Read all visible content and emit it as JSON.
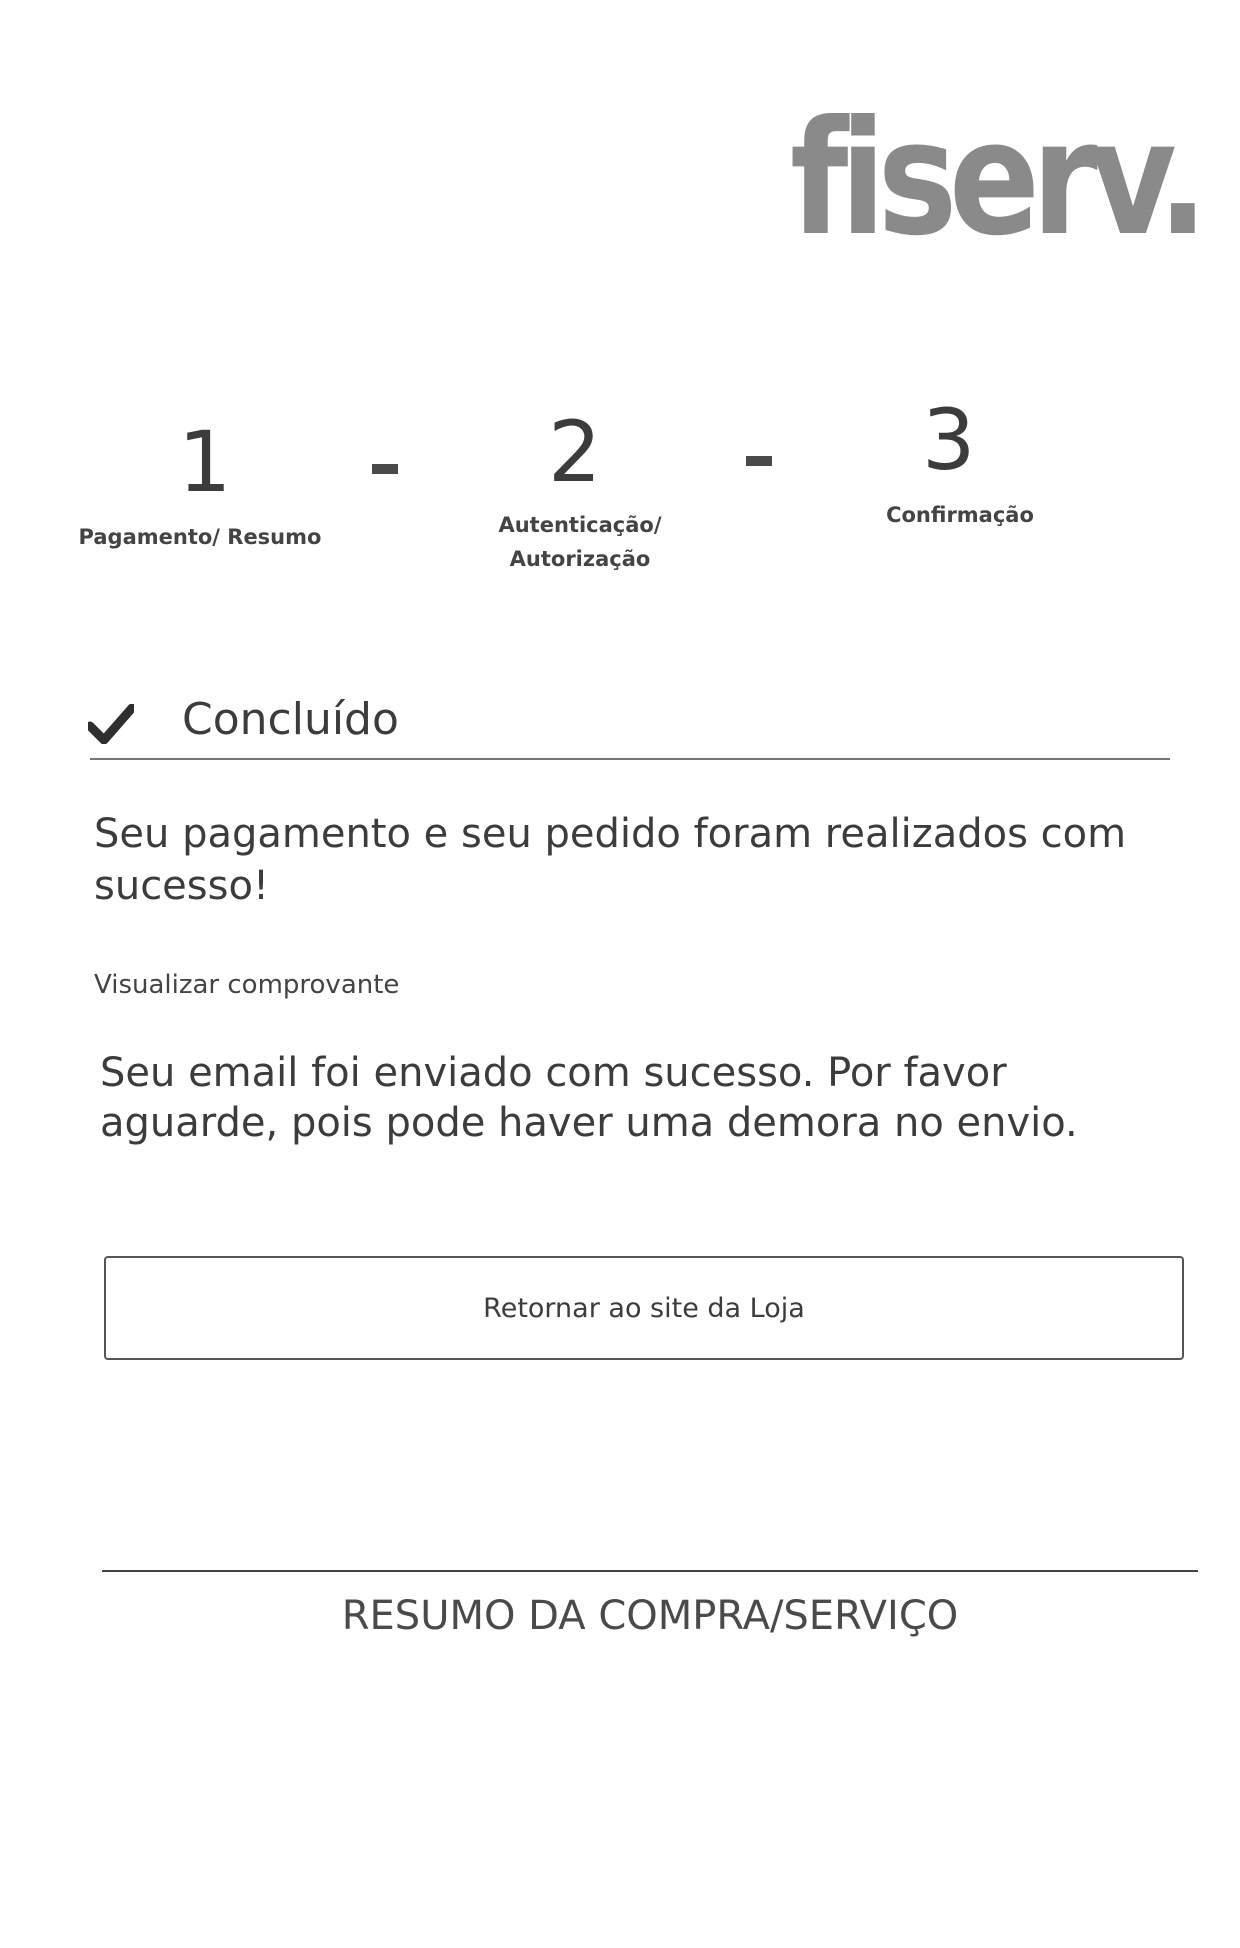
{
  "brand": {
    "logo_text": "fiserv."
  },
  "steps": [
    {
      "number": "1",
      "label": "Pagamento/ Resumo"
    },
    {
      "number": "2",
      "label": "Autenticação/\nAutorização"
    },
    {
      "number": "3",
      "label": "Confirmação"
    }
  ],
  "steps_separator": "-",
  "status": {
    "icon": "check-icon",
    "title": "Concluído"
  },
  "messages": {
    "success": "Seu pagamento e seu pedido foram realizados com sucesso!",
    "view_receipt": "Visualizar comprovante",
    "email": "Seu email foi enviado com sucesso. Por favor aguarde, pois pode haver uma demora no envio."
  },
  "actions": {
    "return_label": "Retornar ao site da Loja"
  },
  "summary": {
    "title": "RESUMO DA COMPRA/SERVIÇO"
  },
  "colors": {
    "text": "#3c3c3c",
    "logo": "#8a8a8a",
    "border": "#555555"
  }
}
